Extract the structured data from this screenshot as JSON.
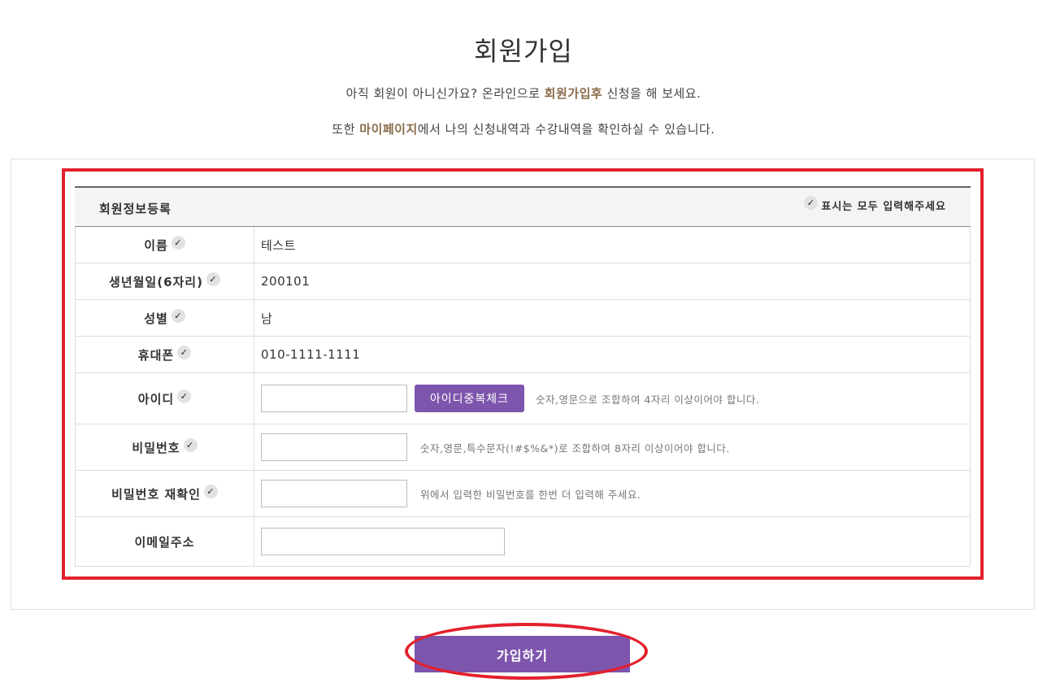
{
  "page": {
    "title": "회원가입",
    "intro1": {
      "before": "아직 회원이 아니신가요? 온라인으로 ",
      "highlight": "회원가입후",
      "after": " 신청을 해 보세요."
    },
    "intro2": {
      "before": "또한 ",
      "highlight": "마이페이지",
      "after": "에서 나의 신청내역과 수강내역을 확인하실 수 있습니다."
    }
  },
  "form": {
    "header_title": "회원정보등록",
    "required_mark": "✓",
    "required_note": "표시는 모두 입력해주세요",
    "rows": {
      "name": {
        "label": "이름",
        "value": "테스트"
      },
      "birth": {
        "label": "생년월일(6자리)",
        "value": "200101"
      },
      "gender": {
        "label": "성별",
        "value": "남"
      },
      "phone": {
        "label": "휴대폰",
        "value": "010-1111-1111"
      },
      "userid": {
        "label": "아이디",
        "value": "",
        "button": "아이디중복체크",
        "hint": "숫자,영문으로 조합하여 4자리 이상이어야 합니다."
      },
      "password": {
        "label": "비밀번호",
        "value": "",
        "hint": "숫자,영문,특수문자(!#$%&*)로 조합하여 8자리 이상이어야 합니다."
      },
      "password_confirm": {
        "label": "비밀번호 재확인",
        "value": "",
        "hint": "위에서 입력한 비밀번호를 한번 더 입력해 주세요."
      },
      "email": {
        "label": "이메일주소",
        "value": ""
      }
    }
  },
  "submit": {
    "label": "가입하기"
  },
  "colors": {
    "accent": "#7e55ad",
    "highlight_text": "#8a6b4a",
    "annotation_red": "#e3202d"
  }
}
